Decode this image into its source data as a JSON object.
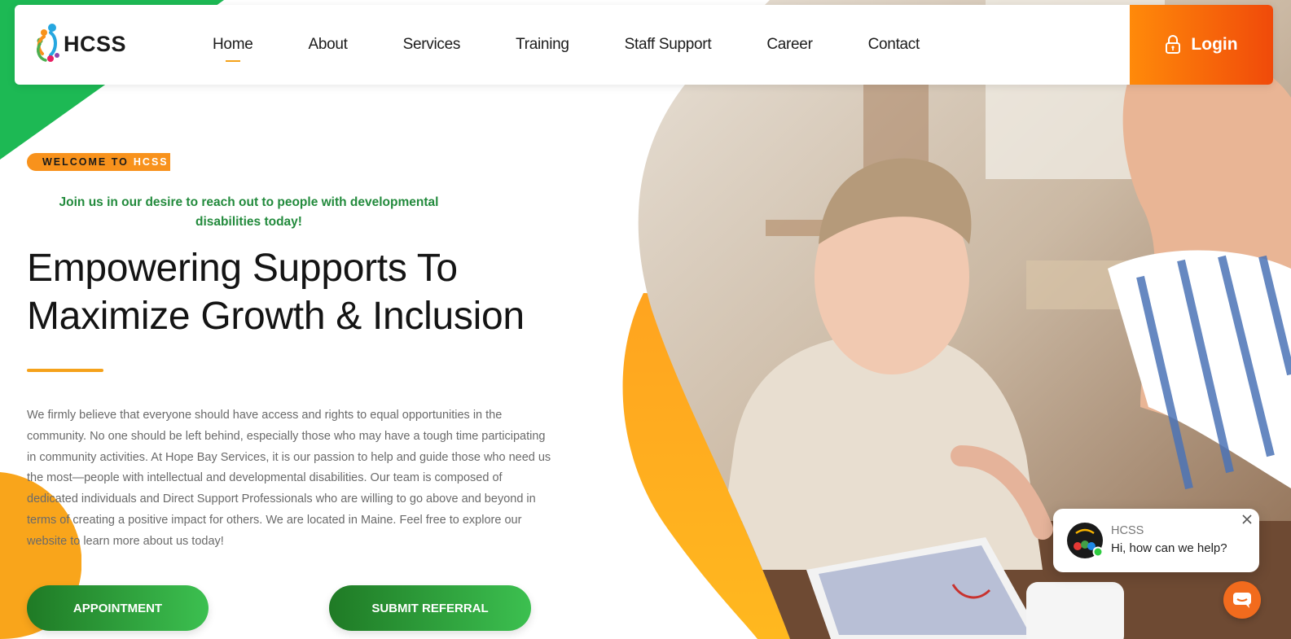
{
  "brand": {
    "name": "HCSS"
  },
  "nav": {
    "items": [
      {
        "label": "Home",
        "active": true
      },
      {
        "label": "About",
        "active": false
      },
      {
        "label": "Services",
        "active": false
      },
      {
        "label": "Training",
        "active": false
      },
      {
        "label": "Staff Support",
        "active": false
      },
      {
        "label": "Career",
        "active": false
      },
      {
        "label": "Contact",
        "active": false
      }
    ],
    "login_label": "Login",
    "login_icon": "lock-icon"
  },
  "hero": {
    "welcome_prefix": "WELCOME TO",
    "welcome_highlight": "HCSS",
    "tagline": "Join us in our desire to reach out to people with developmental disabilities today!",
    "headline_line1": "Empowering Supports To",
    "headline_line2": "Maximize Growth & Inclusion",
    "body": "We firmly believe that everyone should have access and rights to equal opportunities in the community. No one should be left behind, especially those who may have a tough time participating in community activities. At Hope Bay Services, it is our passion to help and guide those who need us the most—people with intellectual and developmental disabilities. Our team is composed of dedicated individuals and Direct Support Professionals who are willing to go above and beyond in terms of creating a positive impact for others. We are located in Maine. Feel free to explore our website to learn more about us today!",
    "buttons": {
      "appointment": "APPOINTMENT",
      "referral": "SUBMIT REFERRAL"
    }
  },
  "chat": {
    "name": "HCSS",
    "message": "Hi, how can we help?",
    "status": "online"
  },
  "colors": {
    "accent_orange": "#f8921c",
    "login_orange": "#f04a0a",
    "brand_green": "#228a3c",
    "button_green": "#2e9e3a",
    "corner_green": "#1db954"
  }
}
